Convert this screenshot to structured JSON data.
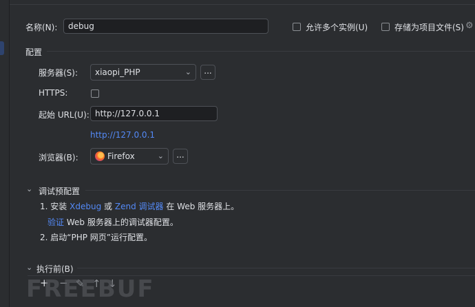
{
  "name": {
    "label": "名称(N):",
    "value": "debug"
  },
  "allow_multiple": {
    "label": "允许多个实例(U)"
  },
  "store_as_project": {
    "label": "存储为项目文件(S)"
  },
  "config": {
    "title": "配置",
    "server": {
      "label": "服务器(S):",
      "value": "xiaopi_PHP",
      "more": "..."
    },
    "https": {
      "label": "HTTPS:"
    },
    "start_url": {
      "label": "起始 URL(U):",
      "value": "http://127.0.0.1",
      "link": "http://127.0.0.1"
    },
    "browser": {
      "label": "浏览器(B):",
      "value": "Firefox",
      "more": "..."
    }
  },
  "debug_preconfig": {
    "title": "调试预配置",
    "step1": {
      "num": "1.",
      "a": "安装",
      "link1": "Xdebug",
      "b": "或",
      "link2": "Zend 调试器",
      "c": "在 Web 服务器上。"
    },
    "verify": {
      "link": "验证",
      "text": "Web 服务器上的调试器配置。"
    },
    "step2": {
      "num": "2.",
      "text": "启动“PHP 网页”运行配置。"
    }
  },
  "before_launch": {
    "title": "执行前(B)"
  },
  "toolbar": {
    "add": "+",
    "remove": "−",
    "edit": "✎",
    "up": "↑",
    "down": "↓"
  },
  "watermark": "FREEBUF"
}
